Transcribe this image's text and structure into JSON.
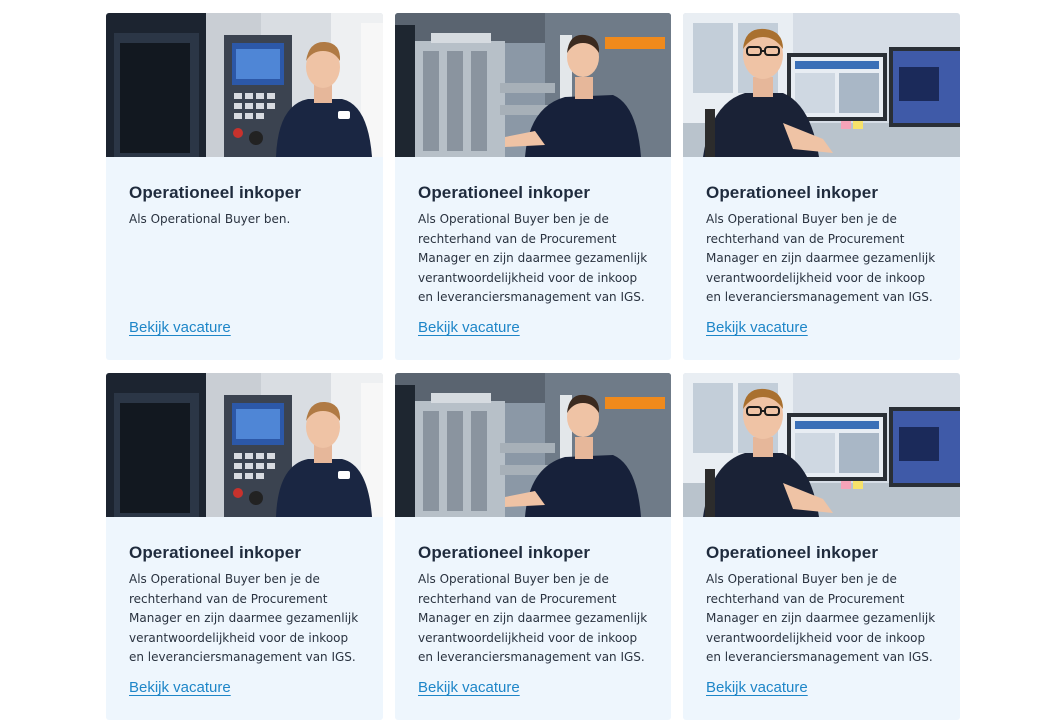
{
  "cards": [
    {
      "title": "Operationeel inkoper",
      "description": "Als Operational Buyer ben.",
      "link": "Bekijk vacature",
      "photo": "cnc-machine-operator"
    },
    {
      "title": "Operationeel inkoper",
      "description": "Als Operational Buyer ben je de rechterhand van de Procurement Manager en zijn daarmee gezamenlijk verantwoordelijkheid voor de inkoop en leveranciersmanagement van IGS.",
      "link": "Bekijk vacature",
      "photo": "mold-technician"
    },
    {
      "title": "Operationeel inkoper",
      "description": "Als Operational Buyer ben je de rechterhand van de Procurement Manager en zijn daarmee gezamenlijk verantwoordelijkheid voor de inkoop en leveranciersmanagement van IGS.",
      "link": "Bekijk vacature",
      "photo": "engineer-at-computer"
    },
    {
      "title": "Operationeel inkoper",
      "description": "Als Operational Buyer ben je de rechterhand van de Procurement Manager en zijn daarmee gezamenlijk verantwoordelijkheid voor de inkoop en leveranciersmanagement van IGS.",
      "link": "Bekijk vacature",
      "photo": "cnc-machine-operator"
    },
    {
      "title": "Operationeel inkoper",
      "description": "Als Operational Buyer ben je de rechterhand van de Procurement Manager en zijn daarmee gezamenlijk verantwoordelijkheid voor de inkoop en leveranciersmanagement van IGS.",
      "link": "Bekijk vacature",
      "photo": "mold-technician"
    },
    {
      "title": "Operationeel inkoper",
      "description": "Als Operational Buyer ben je de rechterhand van de Procurement Manager en zijn daarmee gezamenlijk verantwoordelijkheid voor de inkoop en leveranciersmanagement van IGS.",
      "link": "Bekijk vacature",
      "photo": "engineer-at-computer"
    }
  ]
}
